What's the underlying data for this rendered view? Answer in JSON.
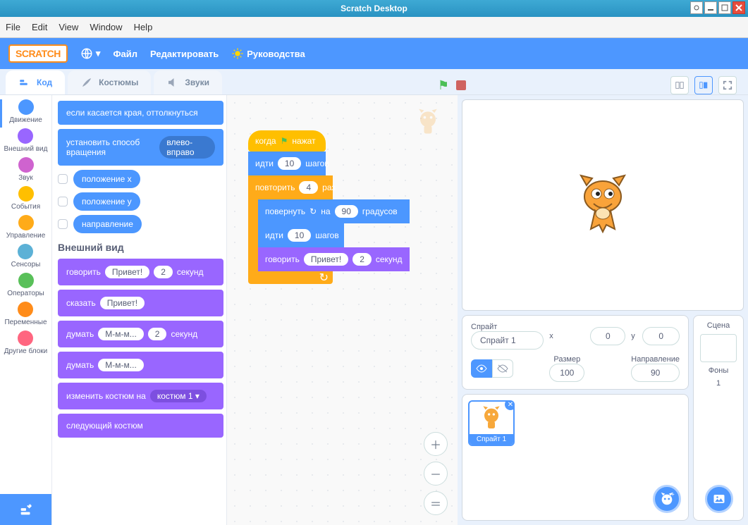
{
  "window": {
    "title": "Scratch Desktop"
  },
  "os_menu": {
    "file": "File",
    "edit": "Edit",
    "view": "View",
    "window": "Window",
    "help": "Help"
  },
  "topbar": {
    "file": "Файл",
    "edit": "Редактировать",
    "tutorials": "Руководства",
    "logo": "SCRATCH"
  },
  "tabs": {
    "code": "Код",
    "costumes": "Костюмы",
    "sounds": "Звуки"
  },
  "categories": {
    "motion": "Движение",
    "looks": "Внешний вид",
    "sound": "Звук",
    "events": "События",
    "control": "Управление",
    "sensing": "Сенсоры",
    "operators": "Операторы",
    "variables": "Переменные",
    "myblocks": "Другие блоки"
  },
  "category_colors": {
    "motion": "#4c97ff",
    "looks": "#9966ff",
    "sound": "#cf63cf",
    "events": "#ffbf00",
    "control": "#ffab19",
    "sensing": "#5cb1d6",
    "operators": "#59c059",
    "variables": "#ff8c1a",
    "myblocks": "#ff6680"
  },
  "palette": {
    "looks_header": "Внешний вид",
    "motion": {
      "if_on_edge_bounce": "если касается края, оттолкнуться",
      "set_rotation_style": "установить способ вращения",
      "rotation_style_value": "влево-вправо",
      "x_position": "положение x",
      "y_position": "положение y",
      "direction": "направление"
    },
    "looks": {
      "say_for": "говорить",
      "say_for_msg": "Привет!",
      "say_for_secs": "2",
      "say_for_tail": "секунд",
      "say": "сказать",
      "say_msg": "Привет!",
      "think_for": "думать",
      "think_for_msg": "М-м-м...",
      "think_for_secs": "2",
      "think_for_tail": "секунд",
      "think": "думать",
      "think_msg": "М-м-м...",
      "switch_costume": "изменить костюм на",
      "switch_costume_val": "костюм 1 ▾",
      "next_costume": "следующий костюм"
    }
  },
  "script": {
    "when_flag": {
      "pre": "когда",
      "post": "нажат"
    },
    "move1": {
      "pre": "идти",
      "val": "10",
      "post": "шагов"
    },
    "repeat": {
      "pre": "повторить",
      "val": "4",
      "post": "раз"
    },
    "turn": {
      "pre": "повернуть",
      "mid": "на",
      "val": "90",
      "post": "градусов"
    },
    "move2": {
      "pre": "идти",
      "val": "10",
      "post": "шагов"
    },
    "say": {
      "pre": "говорить",
      "msg": "Привет!",
      "secs": "2",
      "post": "секунд"
    }
  },
  "sprite_panel": {
    "sprite_label": "Спрайт",
    "sprite_name": "Спрайт 1",
    "x_label": "x",
    "x_val": "0",
    "y_label": "y",
    "y_val": "0",
    "size_label": "Размер",
    "size_val": "100",
    "direction_label": "Направление",
    "direction_val": "90",
    "thumb_name": "Спрайт 1"
  },
  "scene_panel": {
    "title": "Сцена",
    "backdrops_label": "Фоны",
    "backdrops_count": "1"
  }
}
